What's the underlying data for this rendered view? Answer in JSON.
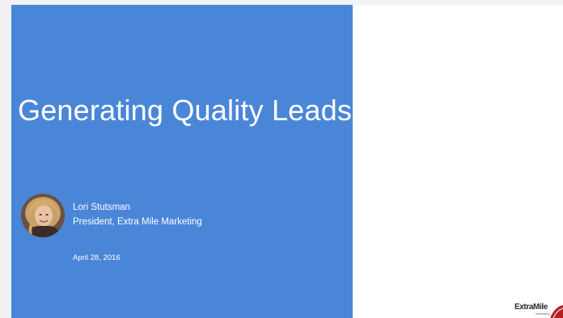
{
  "slide": {
    "title": "Generating Quality Leads",
    "presenter_name": "Lori Stutsman",
    "presenter_role": "President, Extra Mile Marketing",
    "date": "April 28, 2016",
    "background_color": "#4a86d8"
  },
  "brand": {
    "logo_text": "ExtraMile",
    "logo_subtext": "marketing"
  }
}
